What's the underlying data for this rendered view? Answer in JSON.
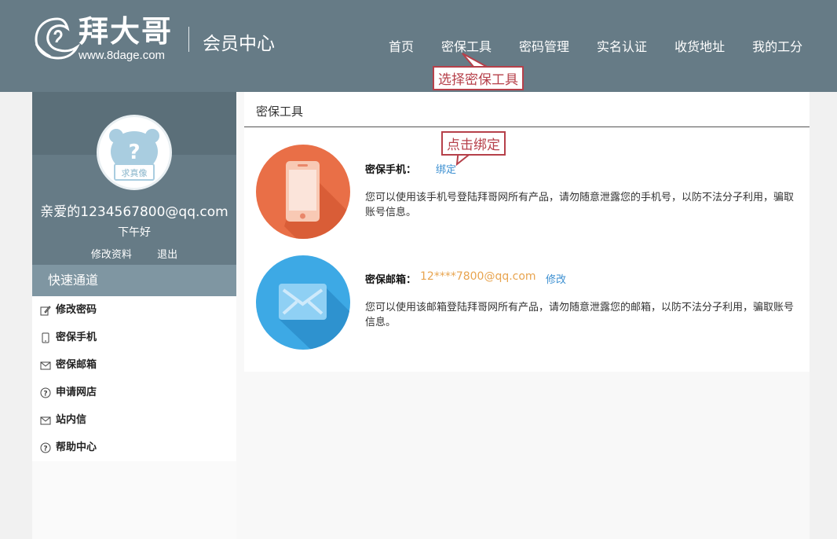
{
  "header": {
    "brand": "拜大哥",
    "url": "www.8dage.com",
    "subtitle": "会员中心",
    "nav": [
      "首页",
      "密保工具",
      "密码管理",
      "实名认证",
      "收货地址",
      "我的工分"
    ]
  },
  "callouts": {
    "select_tool": "选择密保工具",
    "click_bind": "点击绑定"
  },
  "sidebar": {
    "avatar_text": "求真像",
    "email_greeting": "亲爱的1234567800@qq.com",
    "time_greeting": "下午好",
    "edit_profile": "修改资料",
    "logout": "退出",
    "quick_title": "快速通道",
    "menu": [
      {
        "label": "修改密码",
        "icon": "edit-icon"
      },
      {
        "label": "密保手机",
        "icon": "phone-icon"
      },
      {
        "label": "密保邮箱",
        "icon": "mail-icon"
      },
      {
        "label": "申请网店",
        "icon": "question-icon"
      },
      {
        "label": "站内信",
        "icon": "mail-icon"
      },
      {
        "label": "帮助中心",
        "icon": "question-icon"
      }
    ]
  },
  "panel": {
    "title": "密保工具",
    "phone": {
      "label": "密保手机：",
      "action": "绑定",
      "desc": "您可以使用该手机号登陆拜哥网所有产品，请勿随意泄露您的手机号，以防不法分子利用，骗取账号信息。"
    },
    "email": {
      "label": "密保邮箱：",
      "value": "12****7800@qq.com",
      "action": "修改",
      "desc": "您可以使用该邮箱登陆拜哥网所有产品，请勿随意泄露您的邮箱，以防不法分子利用，骗取账号信息。"
    }
  },
  "colors": {
    "header": "#667b86",
    "callout": "#b6404a",
    "phone_circle": "#e96f47",
    "mail_circle": "#3da9e5",
    "link": "#3b8fd1",
    "masked_email": "#e8a44f"
  }
}
